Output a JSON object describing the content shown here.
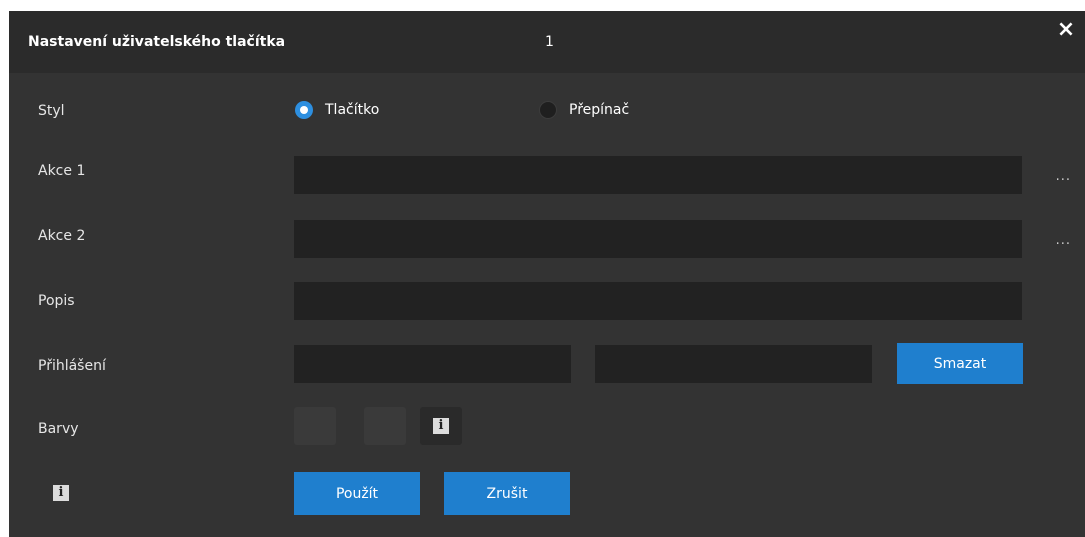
{
  "dialog": {
    "title": "Nastavení uživatelského tlačítka",
    "button_number": "1",
    "close_icon": "×"
  },
  "style_row": {
    "label": "Styl",
    "options": [
      {
        "label": "Tlačítko",
        "selected": true
      },
      {
        "label": "Přepínač",
        "selected": false
      }
    ]
  },
  "action1": {
    "label": "Akce 1",
    "value": "",
    "browse": "..."
  },
  "action2": {
    "label": "Akce 2",
    "value": "",
    "browse": "..."
  },
  "description": {
    "label": "Popis",
    "value": ""
  },
  "login": {
    "label": "Přihlášení",
    "username": "",
    "password": "",
    "clear_label": "Smazat"
  },
  "colors": {
    "label": "Barvy",
    "color1": "#3a3a3a",
    "color2": "#3a3a3a",
    "info_icon": "i"
  },
  "footer": {
    "info_icon": "i",
    "apply_label": "Použít",
    "cancel_label": "Zrušit"
  },
  "accent_color": "#1f7fce"
}
